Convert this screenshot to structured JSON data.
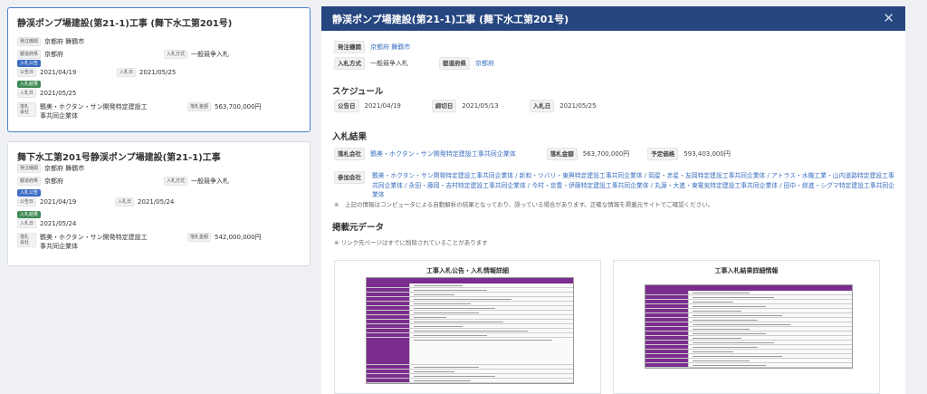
{
  "list": {
    "cards": [
      {
        "title": "静渓ポンプ場建設(第21-1)工事 (舞下水工第201号)",
        "row1_label": "発注機関",
        "row1_value": "京都府 舞鶴市",
        "row2_label": "都道府県",
        "row2_value": "京都府",
        "row2b_label": "入札方式",
        "row2b_value": "一般競争入札",
        "badge_notice": "入札公告",
        "notice_date_label": "公告日",
        "notice_date": "2021/04/19",
        "bid_date_label": "入札日",
        "bid_date": "2021/05/25",
        "badge_result": "入札結果",
        "result_date_label": "入札日",
        "result_date": "2021/05/25",
        "winner_label": "落札会社",
        "winner": "鶴美・ホクタン・サン開発特定建設工事共同企業体",
        "amount_label": "落札金額",
        "amount": "563,700,000円"
      },
      {
        "title": "舞下水工第201号静渓ポンプ場建設(第21-1)工事",
        "row1_label": "発注機関",
        "row1_value": "京都府 舞鶴市",
        "row2_label": "都道府県",
        "row2_value": "京都府",
        "row2b_label": "入札方式",
        "row2b_value": "一般競争入札",
        "badge_notice": "入札公告",
        "notice_date_label": "公告日",
        "notice_date": "2021/04/19",
        "bid_date_label": "入札日",
        "bid_date": "2021/05/24",
        "badge_result": "入札結果",
        "result_date_label": "入札日",
        "result_date": "2021/05/24",
        "winner_label": "落札会社",
        "winner": "鶴美・ホクタン・サン開発特定建設工事共同企業体",
        "amount_label": "落札金額",
        "amount": "542,000,000円"
      }
    ]
  },
  "detail": {
    "title": "静渓ポンプ場建設(第21-1)工事 (舞下水工第201号)",
    "agency_label": "発注機関",
    "agency": "京都府 舞鶴市",
    "method_label": "入札方式",
    "method": "一般競争入札",
    "pref_label": "都道府県",
    "pref": "京都府",
    "schedule_heading": "スケジュール",
    "notice_label": "公告日",
    "notice_date": "2021/04/19",
    "deadline_label": "締切日",
    "deadline_date": "2021/05/13",
    "bid_label": "入札日",
    "bid_date": "2021/05/25",
    "result_heading": "入札結果",
    "winner_label": "落札会社",
    "winner": "鶴美・ホクタン・サン開発特定建設工事共同企業体",
    "amount_label": "落札金額",
    "amount": "563,700,000円",
    "estimate_label": "予定価格",
    "estimate": "593,403,000円",
    "participants_label": "参加会社",
    "participants": "鶴美・ホクタン・サン開発特定建設工事共同企業体 / 新和・ツバリ・東興特定建設工事共同企業体 / 岡星・赤星・友岡特定建設工事共同企業体 / アトラス・水機工業・山内道路特定建設工事共同企業体 / 永田・藤岡・吉村特定建設工事共同企業体 / 今村・京豊・伊藤特定建設工事共同企業体 / 丸源・大進・東電気特定建設工事共同企業体 / 田中・総進・シグマ特定建設工事共同企業体",
    "disclaimer": "※　上記の情報はコンピュータによる自動解析の結果となっており、誤っている場合があります。正確な情報を掲載元サイトでご確認ください。",
    "source_heading": "掲載元データ",
    "source_note": "※ リンク先ページはすでに削除されていることがあります",
    "thumb1_title": "工事入札公告・入札情報詳細",
    "thumb2_title": "工事入札結果詳細情報"
  }
}
